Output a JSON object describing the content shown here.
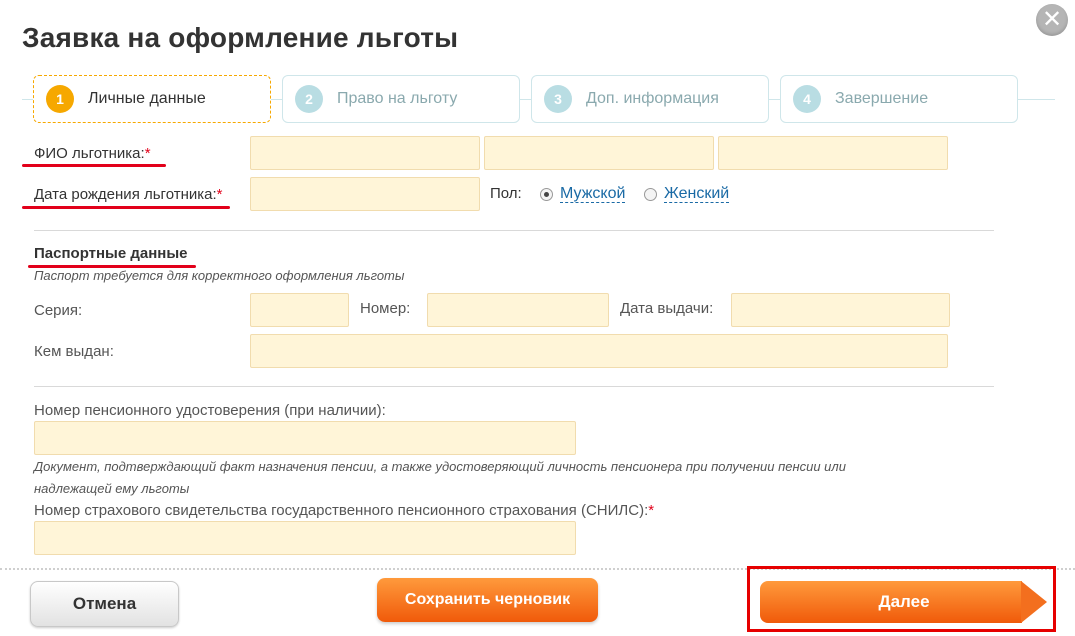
{
  "dialog": {
    "title": "Заявка на оформление льготы",
    "close_symbol": "✕"
  },
  "steps": [
    {
      "number": "1",
      "label": "Личные данные"
    },
    {
      "number": "2",
      "label": "Право на льготу"
    },
    {
      "number": "3",
      "label": "Доп. информация"
    },
    {
      "number": "4",
      "label": "Завершение"
    }
  ],
  "personal": {
    "fio_label": "ФИО льготника:",
    "birth_label": "Дата рождения льготника:",
    "required_mark": "*",
    "gender_label": "Пол:",
    "gender_options": [
      "Мужской",
      "Женский"
    ],
    "gender_selected": "Мужской"
  },
  "passport": {
    "title": "Паспортные данные",
    "hint": "Паспорт требуется для корректного оформления льготы",
    "series_label": "Серия:",
    "number_label": "Номер:",
    "issue_date_label": "Дата выдачи:",
    "issued_by_label": "Кем выдан:"
  },
  "pension": {
    "label": "Номер пенсионного удостоверения (при наличии):",
    "hint_line1": "Документ, подтверждающий факт назначения пенсии, а также удостоверяющий личность пенсионера при получении пенсии или",
    "hint_line2": "надлежащей ему льготы"
  },
  "snils": {
    "label": "Номер страхового свидетельства государственного пенсионного страхования (СНИЛС):"
  },
  "buttons": {
    "cancel": "Отмена",
    "save_draft": "Сохранить черновик",
    "next": "Далее"
  },
  "colors": {
    "accent_orange": "#f6a800",
    "button_orange": "#f05a0a",
    "input_bg": "#fff5d8",
    "required_red": "#e2001a",
    "link_blue": "#1a6aa5"
  }
}
